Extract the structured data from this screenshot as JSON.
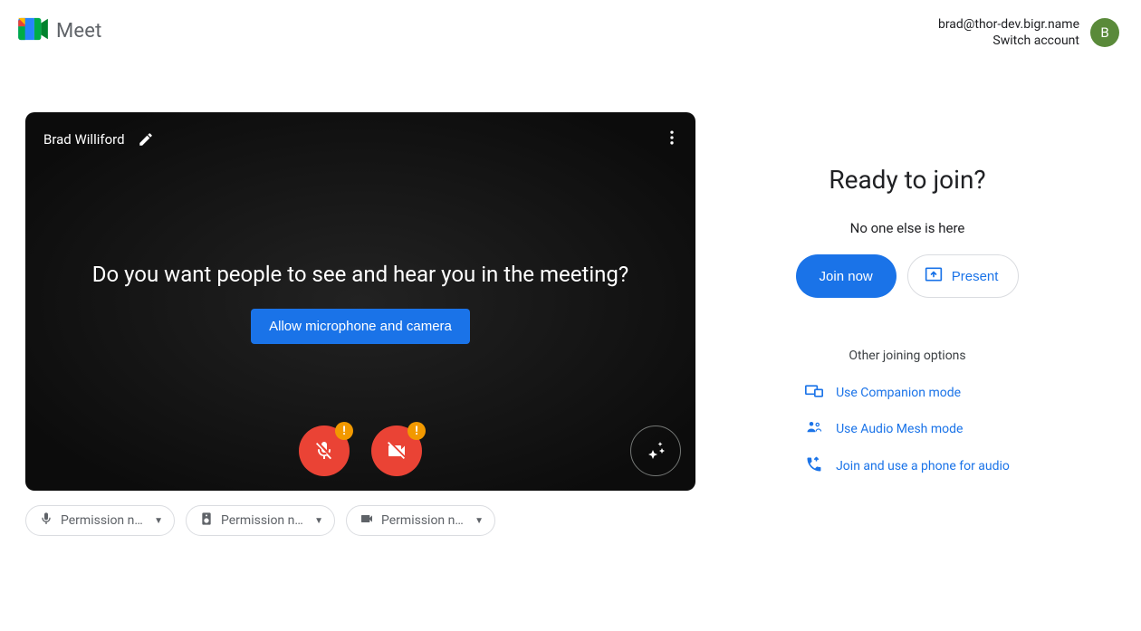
{
  "header": {
    "product": "Meet",
    "account_email": "brad@thor-dev.bigr.name",
    "switch_label": "Switch account",
    "avatar_initial": "B"
  },
  "preview": {
    "user_name": "Brad Williford",
    "question": "Do you want people to see and hear you in the meeting?",
    "allow_label": "Allow microphone and camera",
    "warn_badge": "!"
  },
  "perm": {
    "mic": "Permission ne…",
    "speaker": "Permission ne…",
    "camera": "Permission ne…"
  },
  "join": {
    "heading": "Ready to join?",
    "sub": "No one else is here",
    "join_label": "Join now",
    "present_label": "Present",
    "options_header": "Other joining options",
    "companion": "Use Companion mode",
    "audio_mesh": "Use Audio Mesh mode",
    "phone": "Join and use a phone for audio"
  }
}
